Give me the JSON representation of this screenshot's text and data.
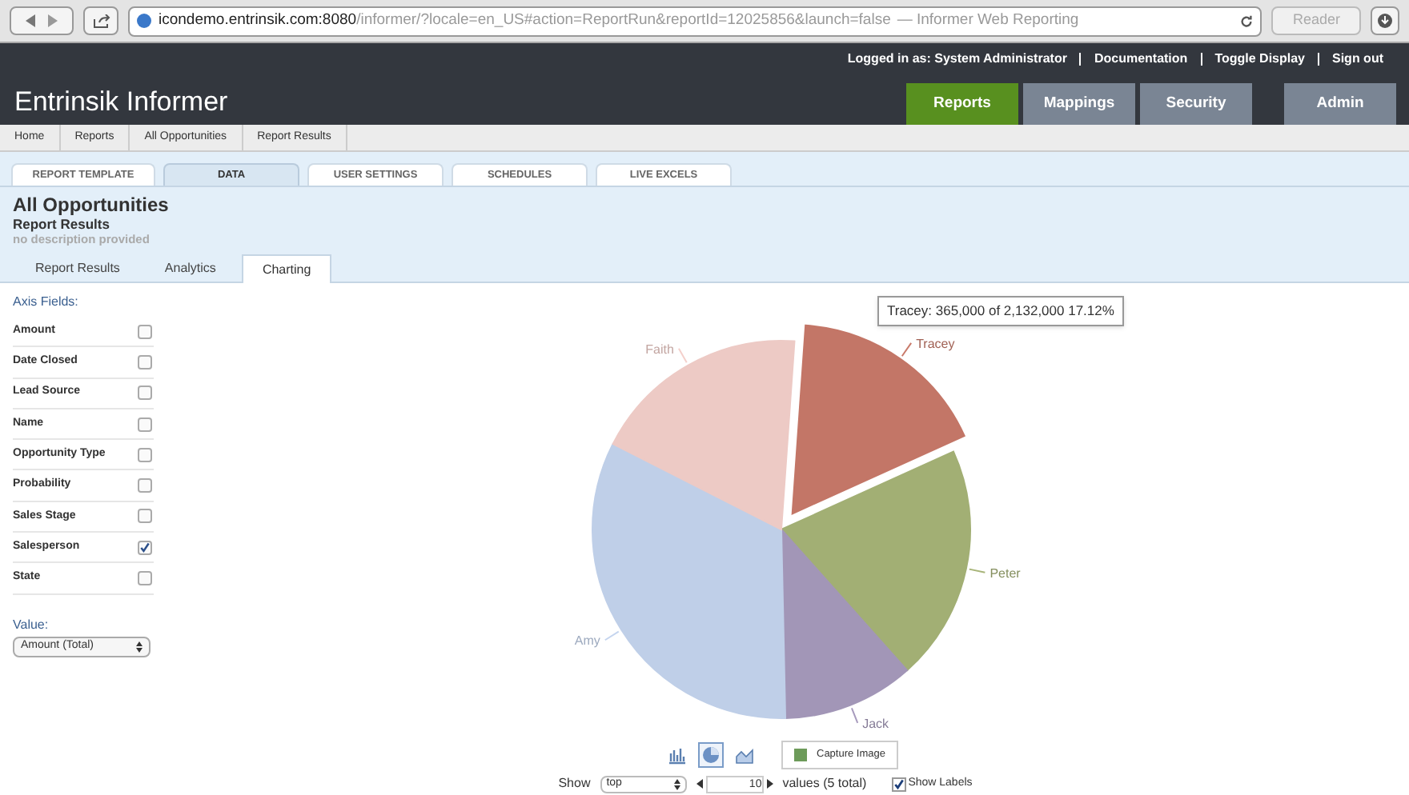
{
  "browser": {
    "url_host": "icondemo.entrinsik.com:8080",
    "url_rest": "/informer/?locale=en_US#action=ReportRun&reportId=12025856&launch=false",
    "page_title": "— Informer Web Reporting",
    "reader": "Reader"
  },
  "header": {
    "logo": "Entrinsik Informer",
    "user": "Logged in as: System Administrator",
    "links": [
      "Documentation",
      "Toggle Display",
      "Sign out"
    ],
    "nav": [
      {
        "label": "Reports",
        "selected": true
      },
      {
        "label": "Mappings",
        "selected": false
      },
      {
        "label": "Security",
        "selected": false
      },
      {
        "label": "Admin",
        "selected": false
      }
    ]
  },
  "breadcrumb": [
    "Home",
    "Reports",
    "All Opportunities",
    "Report Results"
  ],
  "tabs": [
    {
      "label": "REPORT TEMPLATE",
      "selected": false
    },
    {
      "label": "DATA",
      "selected": true
    },
    {
      "label": "USER SETTINGS",
      "selected": false
    },
    {
      "label": "SCHEDULES",
      "selected": false
    },
    {
      "label": "LIVE EXCELS",
      "selected": false
    }
  ],
  "report": {
    "title": "All Opportunities",
    "subtitle": "Report Results",
    "description": "no description provided"
  },
  "subtabs": [
    {
      "label": "Report Results",
      "selected": false
    },
    {
      "label": "Analytics",
      "selected": false
    },
    {
      "label": "Charting",
      "selected": true
    }
  ],
  "axis_fields_label": "Axis Fields:",
  "axis_fields": [
    {
      "label": "Amount",
      "checked": false
    },
    {
      "label": "Date Closed",
      "checked": false
    },
    {
      "label": "Lead Source",
      "checked": false
    },
    {
      "label": "Name",
      "checked": false
    },
    {
      "label": "Opportunity Type",
      "checked": false
    },
    {
      "label": "Probability",
      "checked": false
    },
    {
      "label": "Sales Stage",
      "checked": false
    },
    {
      "label": "Salesperson",
      "checked": true
    },
    {
      "label": "State",
      "checked": false
    }
  ],
  "value_label": "Value:",
  "value_select": "Amount (Total)",
  "chart": {
    "tooltip": "Tracey: 365,000 of 2,132,000 17.12%",
    "chart_data": {
      "type": "pie",
      "categories": [
        "Tracey",
        "Peter",
        "Jack",
        "Amy",
        "Faith"
      ],
      "series": [
        {
          "values": [
            17.12,
            20.17,
            11.26,
            32.83,
            18.62
          ]
        }
      ],
      "colors": [
        "#c97a6a",
        "#a7b478",
        "#a79bbd",
        "#c5d5ef",
        "#f4d0cb"
      ]
    }
  },
  "chart_types": [
    {
      "kind": "bar",
      "selected": false
    },
    {
      "kind": "pie",
      "selected": true
    },
    {
      "kind": "area",
      "selected": false
    }
  ],
  "capture_button": "Capture Image",
  "show": {
    "label": "Show",
    "mode": "top",
    "count": "10",
    "suffix": "values (5 total)",
    "show_labels": {
      "label": "Show Labels",
      "checked": true
    }
  }
}
